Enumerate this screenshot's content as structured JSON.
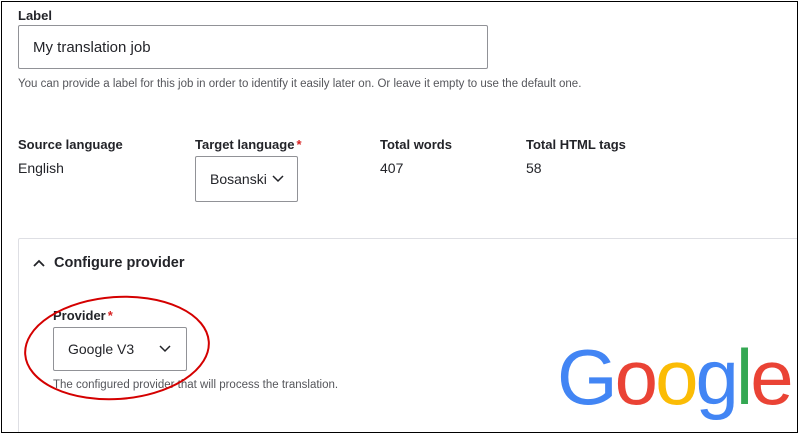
{
  "label_field": {
    "heading": "Label",
    "value": "My translation job",
    "help": "You can provide a label for this job in order to identify it easily later on. Or leave it empty to use the default one."
  },
  "source_language": {
    "title": "Source language",
    "value": "English"
  },
  "target_language": {
    "title": "Target language",
    "required_mark": "*",
    "selected": "Bosanski",
    "icon": "chevron-down-icon"
  },
  "total_words": {
    "title": "Total words",
    "value": "407"
  },
  "total_html_tags": {
    "title": "Total HTML tags",
    "value": "58"
  },
  "configure_provider": {
    "title": "Configure provider",
    "icon": "chevron-up-icon",
    "provider": {
      "title": "Provider",
      "required_mark": "*",
      "selected": "Google V3",
      "icon": "chevron-down-icon",
      "help": "The configured provider that will process the translation."
    }
  },
  "logo": {
    "letters": [
      "G",
      "o",
      "o",
      "g",
      "l",
      "e"
    ],
    "colors": [
      "#4285F4",
      "#EA4335",
      "#FBBC05",
      "#4285F4",
      "#34A853",
      "#EA4335"
    ]
  },
  "annotation": {
    "shape": "ellipse",
    "color": "#d40000"
  },
  "colors": {
    "required": "#d72222",
    "text": "#232429",
    "help_text": "#55565b",
    "border": "#919297"
  }
}
